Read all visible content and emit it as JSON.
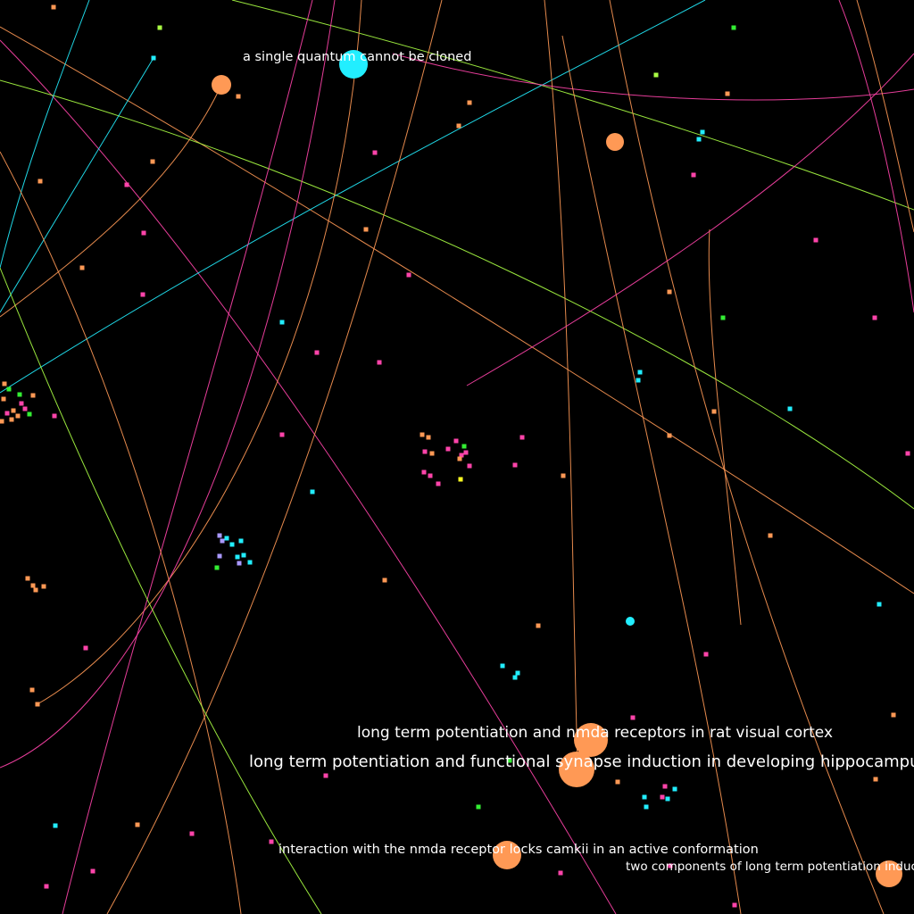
{
  "labels": [
    {
      "id": "lbl-quantum",
      "text": "a single quantum cannot be cloned"
    },
    {
      "id": "lbl-ltp-nmda",
      "text": "long term potentiation and nmda receptors in rat visual cortex"
    },
    {
      "id": "lbl-ltp-synapse",
      "text": "long term potentiation and functional synapse induction in developing hippocampus"
    },
    {
      "id": "lbl-camkii",
      "text": "interaction with the nmda receptor locks camkii in an active conformation"
    },
    {
      "id": "lbl-two-components",
      "text": "two components of long term potentiation induced"
    }
  ],
  "colors": {
    "background": "#000000",
    "orange": "#ff9955",
    "cyan": "#22eeff",
    "magenta": "#ff44aa",
    "green": "#33ee33",
    "lime": "#aaff44",
    "lavender": "#aa99ff",
    "yellow": "#ffff22",
    "label": "#ffffff"
  }
}
